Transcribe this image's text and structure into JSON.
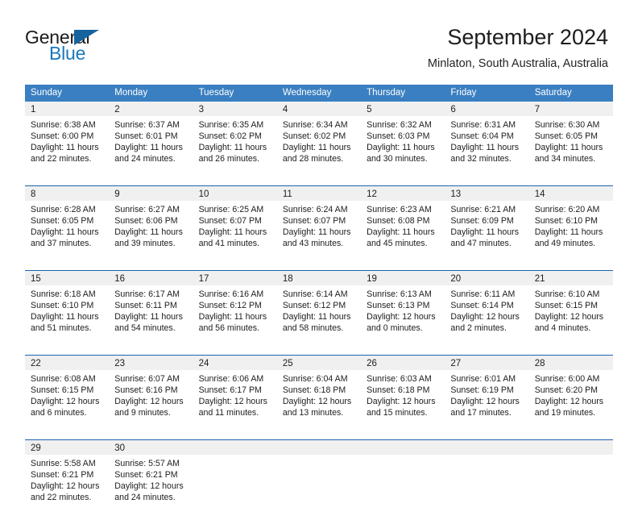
{
  "logo": {
    "word_primary": "General",
    "word_secondary": "Blue",
    "triangle_icon": "triangle-icon",
    "primary_color": "#1b1b1b",
    "secondary_color": "#1878be",
    "triangle_color": "#17639f"
  },
  "header": {
    "title": "September 2024",
    "subtitle": "Minlaton, South Australia, Australia"
  },
  "theme": {
    "header_row_bg": "#3a7fc1",
    "week_divider": "#1b65ad",
    "day_number_band": "#f0f0f0",
    "text": "#1d1d1d"
  },
  "weekday_headers": [
    "Sunday",
    "Monday",
    "Tuesday",
    "Wednesday",
    "Thursday",
    "Friday",
    "Saturday"
  ],
  "weeks": [
    [
      {
        "day": "1",
        "sunrise": "Sunrise: 6:38 AM",
        "sunset": "Sunset: 6:00 PM",
        "daylight1": "Daylight: 11 hours",
        "daylight2": "and 22 minutes."
      },
      {
        "day": "2",
        "sunrise": "Sunrise: 6:37 AM",
        "sunset": "Sunset: 6:01 PM",
        "daylight1": "Daylight: 11 hours",
        "daylight2": "and 24 minutes."
      },
      {
        "day": "3",
        "sunrise": "Sunrise: 6:35 AM",
        "sunset": "Sunset: 6:02 PM",
        "daylight1": "Daylight: 11 hours",
        "daylight2": "and 26 minutes."
      },
      {
        "day": "4",
        "sunrise": "Sunrise: 6:34 AM",
        "sunset": "Sunset: 6:02 PM",
        "daylight1": "Daylight: 11 hours",
        "daylight2": "and 28 minutes."
      },
      {
        "day": "5",
        "sunrise": "Sunrise: 6:32 AM",
        "sunset": "Sunset: 6:03 PM",
        "daylight1": "Daylight: 11 hours",
        "daylight2": "and 30 minutes."
      },
      {
        "day": "6",
        "sunrise": "Sunrise: 6:31 AM",
        "sunset": "Sunset: 6:04 PM",
        "daylight1": "Daylight: 11 hours",
        "daylight2": "and 32 minutes."
      },
      {
        "day": "7",
        "sunrise": "Sunrise: 6:30 AM",
        "sunset": "Sunset: 6:05 PM",
        "daylight1": "Daylight: 11 hours",
        "daylight2": "and 34 minutes."
      }
    ],
    [
      {
        "day": "8",
        "sunrise": "Sunrise: 6:28 AM",
        "sunset": "Sunset: 6:05 PM",
        "daylight1": "Daylight: 11 hours",
        "daylight2": "and 37 minutes."
      },
      {
        "day": "9",
        "sunrise": "Sunrise: 6:27 AM",
        "sunset": "Sunset: 6:06 PM",
        "daylight1": "Daylight: 11 hours",
        "daylight2": "and 39 minutes."
      },
      {
        "day": "10",
        "sunrise": "Sunrise: 6:25 AM",
        "sunset": "Sunset: 6:07 PM",
        "daylight1": "Daylight: 11 hours",
        "daylight2": "and 41 minutes."
      },
      {
        "day": "11",
        "sunrise": "Sunrise: 6:24 AM",
        "sunset": "Sunset: 6:07 PM",
        "daylight1": "Daylight: 11 hours",
        "daylight2": "and 43 minutes."
      },
      {
        "day": "12",
        "sunrise": "Sunrise: 6:23 AM",
        "sunset": "Sunset: 6:08 PM",
        "daylight1": "Daylight: 11 hours",
        "daylight2": "and 45 minutes."
      },
      {
        "day": "13",
        "sunrise": "Sunrise: 6:21 AM",
        "sunset": "Sunset: 6:09 PM",
        "daylight1": "Daylight: 11 hours",
        "daylight2": "and 47 minutes."
      },
      {
        "day": "14",
        "sunrise": "Sunrise: 6:20 AM",
        "sunset": "Sunset: 6:10 PM",
        "daylight1": "Daylight: 11 hours",
        "daylight2": "and 49 minutes."
      }
    ],
    [
      {
        "day": "15",
        "sunrise": "Sunrise: 6:18 AM",
        "sunset": "Sunset: 6:10 PM",
        "daylight1": "Daylight: 11 hours",
        "daylight2": "and 51 minutes."
      },
      {
        "day": "16",
        "sunrise": "Sunrise: 6:17 AM",
        "sunset": "Sunset: 6:11 PM",
        "daylight1": "Daylight: 11 hours",
        "daylight2": "and 54 minutes."
      },
      {
        "day": "17",
        "sunrise": "Sunrise: 6:16 AM",
        "sunset": "Sunset: 6:12 PM",
        "daylight1": "Daylight: 11 hours",
        "daylight2": "and 56 minutes."
      },
      {
        "day": "18",
        "sunrise": "Sunrise: 6:14 AM",
        "sunset": "Sunset: 6:12 PM",
        "daylight1": "Daylight: 11 hours",
        "daylight2": "and 58 minutes."
      },
      {
        "day": "19",
        "sunrise": "Sunrise: 6:13 AM",
        "sunset": "Sunset: 6:13 PM",
        "daylight1": "Daylight: 12 hours",
        "daylight2": "and 0 minutes."
      },
      {
        "day": "20",
        "sunrise": "Sunrise: 6:11 AM",
        "sunset": "Sunset: 6:14 PM",
        "daylight1": "Daylight: 12 hours",
        "daylight2": "and 2 minutes."
      },
      {
        "day": "21",
        "sunrise": "Sunrise: 6:10 AM",
        "sunset": "Sunset: 6:15 PM",
        "daylight1": "Daylight: 12 hours",
        "daylight2": "and 4 minutes."
      }
    ],
    [
      {
        "day": "22",
        "sunrise": "Sunrise: 6:08 AM",
        "sunset": "Sunset: 6:15 PM",
        "daylight1": "Daylight: 12 hours",
        "daylight2": "and 6 minutes."
      },
      {
        "day": "23",
        "sunrise": "Sunrise: 6:07 AM",
        "sunset": "Sunset: 6:16 PM",
        "daylight1": "Daylight: 12 hours",
        "daylight2": "and 9 minutes."
      },
      {
        "day": "24",
        "sunrise": "Sunrise: 6:06 AM",
        "sunset": "Sunset: 6:17 PM",
        "daylight1": "Daylight: 12 hours",
        "daylight2": "and 11 minutes."
      },
      {
        "day": "25",
        "sunrise": "Sunrise: 6:04 AM",
        "sunset": "Sunset: 6:18 PM",
        "daylight1": "Daylight: 12 hours",
        "daylight2": "and 13 minutes."
      },
      {
        "day": "26",
        "sunrise": "Sunrise: 6:03 AM",
        "sunset": "Sunset: 6:18 PM",
        "daylight1": "Daylight: 12 hours",
        "daylight2": "and 15 minutes."
      },
      {
        "day": "27",
        "sunrise": "Sunrise: 6:01 AM",
        "sunset": "Sunset: 6:19 PM",
        "daylight1": "Daylight: 12 hours",
        "daylight2": "and 17 minutes."
      },
      {
        "day": "28",
        "sunrise": "Sunrise: 6:00 AM",
        "sunset": "Sunset: 6:20 PM",
        "daylight1": "Daylight: 12 hours",
        "daylight2": "and 19 minutes."
      }
    ],
    [
      {
        "day": "29",
        "sunrise": "Sunrise: 5:58 AM",
        "sunset": "Sunset: 6:21 PM",
        "daylight1": "Daylight: 12 hours",
        "daylight2": "and 22 minutes."
      },
      {
        "day": "30",
        "sunrise": "Sunrise: 5:57 AM",
        "sunset": "Sunset: 6:21 PM",
        "daylight1": "Daylight: 12 hours",
        "daylight2": "and 24 minutes."
      },
      {
        "day": "",
        "sunrise": "",
        "sunset": "",
        "daylight1": "",
        "daylight2": ""
      },
      {
        "day": "",
        "sunrise": "",
        "sunset": "",
        "daylight1": "",
        "daylight2": ""
      },
      {
        "day": "",
        "sunrise": "",
        "sunset": "",
        "daylight1": "",
        "daylight2": ""
      },
      {
        "day": "",
        "sunrise": "",
        "sunset": "",
        "daylight1": "",
        "daylight2": ""
      },
      {
        "day": "",
        "sunrise": "",
        "sunset": "",
        "daylight1": "",
        "daylight2": ""
      }
    ]
  ]
}
